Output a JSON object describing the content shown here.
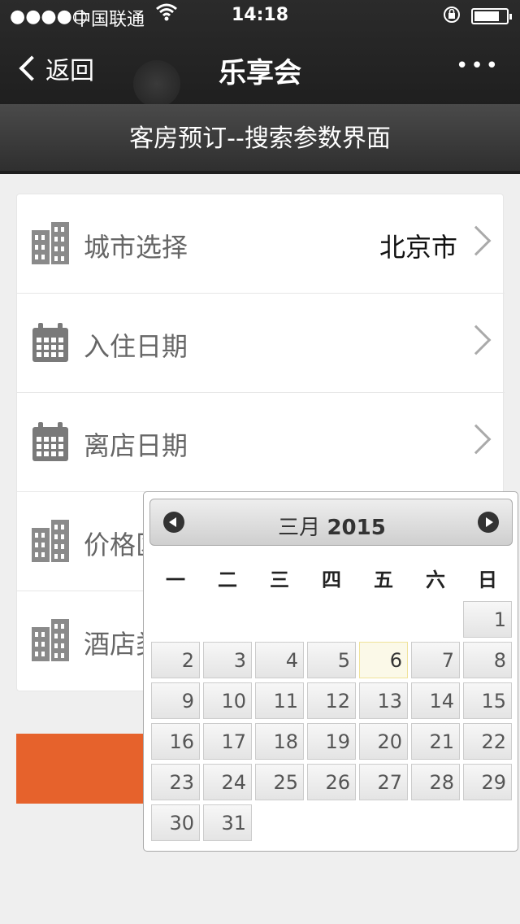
{
  "status_bar": {
    "signal": "●●●●○",
    "carrier": "中国联通",
    "time": "14:18"
  },
  "nav": {
    "back_label": "返回",
    "title": "乐享会",
    "more_label": "•••"
  },
  "subheader": {
    "title": "客房预订--搜索参数界面"
  },
  "rows": [
    {
      "label": "城市选择",
      "value": "北京市",
      "icon": "building-icon"
    },
    {
      "label": "入住日期",
      "value": "",
      "icon": "calendar-icon"
    },
    {
      "label": "离店日期",
      "value": "",
      "icon": "calendar-icon"
    },
    {
      "label": "价格区",
      "value": "",
      "icon": "building-icon"
    },
    {
      "label": "酒店类",
      "value": "",
      "icon": "building-icon"
    }
  ],
  "datepicker": {
    "month": "三月",
    "year": "2015",
    "weekdays": [
      "一",
      "二",
      "三",
      "四",
      "五",
      "六",
      "日"
    ],
    "weeks": [
      [
        "",
        "",
        "",
        "",
        "",
        "",
        "1"
      ],
      [
        "2",
        "3",
        "4",
        "5",
        "6",
        "7",
        "8"
      ],
      [
        "9",
        "10",
        "11",
        "12",
        "13",
        "14",
        "15"
      ],
      [
        "16",
        "17",
        "18",
        "19",
        "20",
        "21",
        "22"
      ],
      [
        "23",
        "24",
        "25",
        "26",
        "27",
        "28",
        "29"
      ],
      [
        "30",
        "31",
        "",
        "",
        "",
        "",
        ""
      ]
    ],
    "today": "6"
  },
  "colors": {
    "accent": "#e6622c",
    "bar": "#1f1f1f"
  }
}
